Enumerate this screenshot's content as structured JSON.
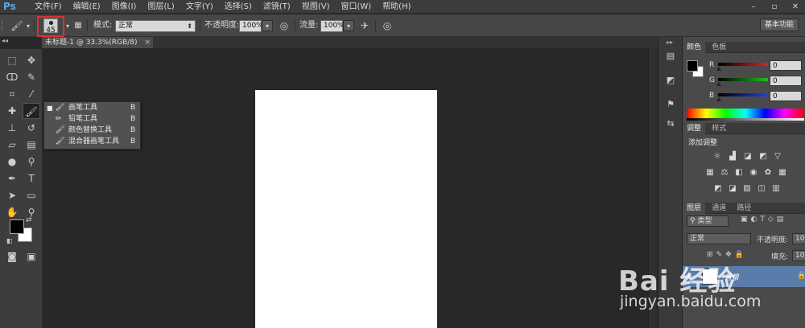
{
  "app": {
    "logo": "Ps"
  },
  "menu": [
    "文件(F)",
    "编辑(E)",
    "图像(I)",
    "图层(L)",
    "文字(Y)",
    "选择(S)",
    "滤镜(T)",
    "视图(V)",
    "窗口(W)",
    "帮助(H)"
  ],
  "window_controls": {
    "minimize": "–",
    "restore": "▫",
    "close": "✕"
  },
  "options_bar": {
    "brush_size": "45",
    "mode_label": "模式:",
    "mode_value": "正常",
    "opacity_label": "不透明度:",
    "opacity_value": "100%",
    "flow_label": "流量:",
    "flow_value": "100%",
    "workspace": "基本功能"
  },
  "document_tab": {
    "title": "未标题-1 @ 33.3%(RGB/8)",
    "close": "×"
  },
  "tool_flyout": [
    {
      "bullet": "■",
      "label": "画笔工具",
      "key": "B"
    },
    {
      "bullet": "",
      "label": "铅笔工具",
      "key": "B"
    },
    {
      "bullet": "",
      "label": "颜色替换工具",
      "key": "B"
    },
    {
      "bullet": "",
      "label": "混合器画笔工具",
      "key": "B"
    }
  ],
  "color_panel": {
    "tabs": [
      "颜色",
      "色板"
    ],
    "channels": [
      {
        "label": "R",
        "value": "0",
        "color": "#e02020"
      },
      {
        "label": "G",
        "value": "0",
        "color": "#20c020"
      },
      {
        "label": "B",
        "value": "0",
        "color": "#2040e0"
      }
    ]
  },
  "adjustments_panel": {
    "tabs": [
      "调整",
      "样式"
    ],
    "heading": "添加调整"
  },
  "layers_panel": {
    "tabs": [
      "图层",
      "通道",
      "路径"
    ],
    "filter_label": "类型",
    "blend_mode": "正常",
    "opacity_label": "不透明度:",
    "opacity_value": "100",
    "fill_label": "填充:",
    "fill_value": "100",
    "layer_name": "背景"
  },
  "watermark": {
    "logo": "Bai 经验",
    "url": "jingyan.baidu.com"
  }
}
